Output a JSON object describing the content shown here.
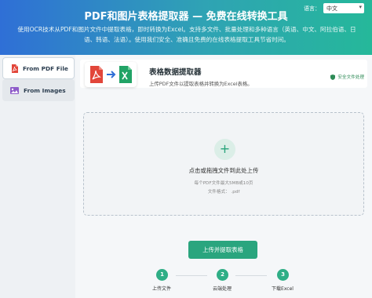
{
  "header": {
    "title": "PDF和图片表格提取器 — 免费在线转换工具",
    "description": "使用OCR技术从PDF和图片文件中提取表格，即时转换为Excel。支持多文件、批量处理和多种语言（英语、中文、阿拉伯语、日语、韩语、法语）。使用我们安全、准确且免费的在线表格提取工具节省时间。",
    "language_label": "语言：",
    "language_value": "中文"
  },
  "sidebar": {
    "items": [
      {
        "label": "From PDF File",
        "icon": "pdf-file-icon",
        "active": true
      },
      {
        "label": "From Images",
        "icon": "image-icon",
        "active": false
      }
    ]
  },
  "card": {
    "title": "表格数据提取器",
    "subtitle": "上传PDF文件以提取表格并转换为Excel表格。",
    "badge": "安全文件处理"
  },
  "dropzone": {
    "text": "点击或拖拽文件到此处上传",
    "hint": "每个PDF文件最大5MB或10页",
    "format": "文件格式：  .pdf"
  },
  "upload_button": "上传并提取表格",
  "steps": [
    {
      "number": "1",
      "label": "上传文件"
    },
    {
      "number": "2",
      "label": "云端处理"
    },
    {
      "number": "3",
      "label": "下载Excel"
    }
  ],
  "colors": {
    "accent": "#2aa57e",
    "header_start": "#2f6fd6",
    "header_end": "#25b89a"
  }
}
